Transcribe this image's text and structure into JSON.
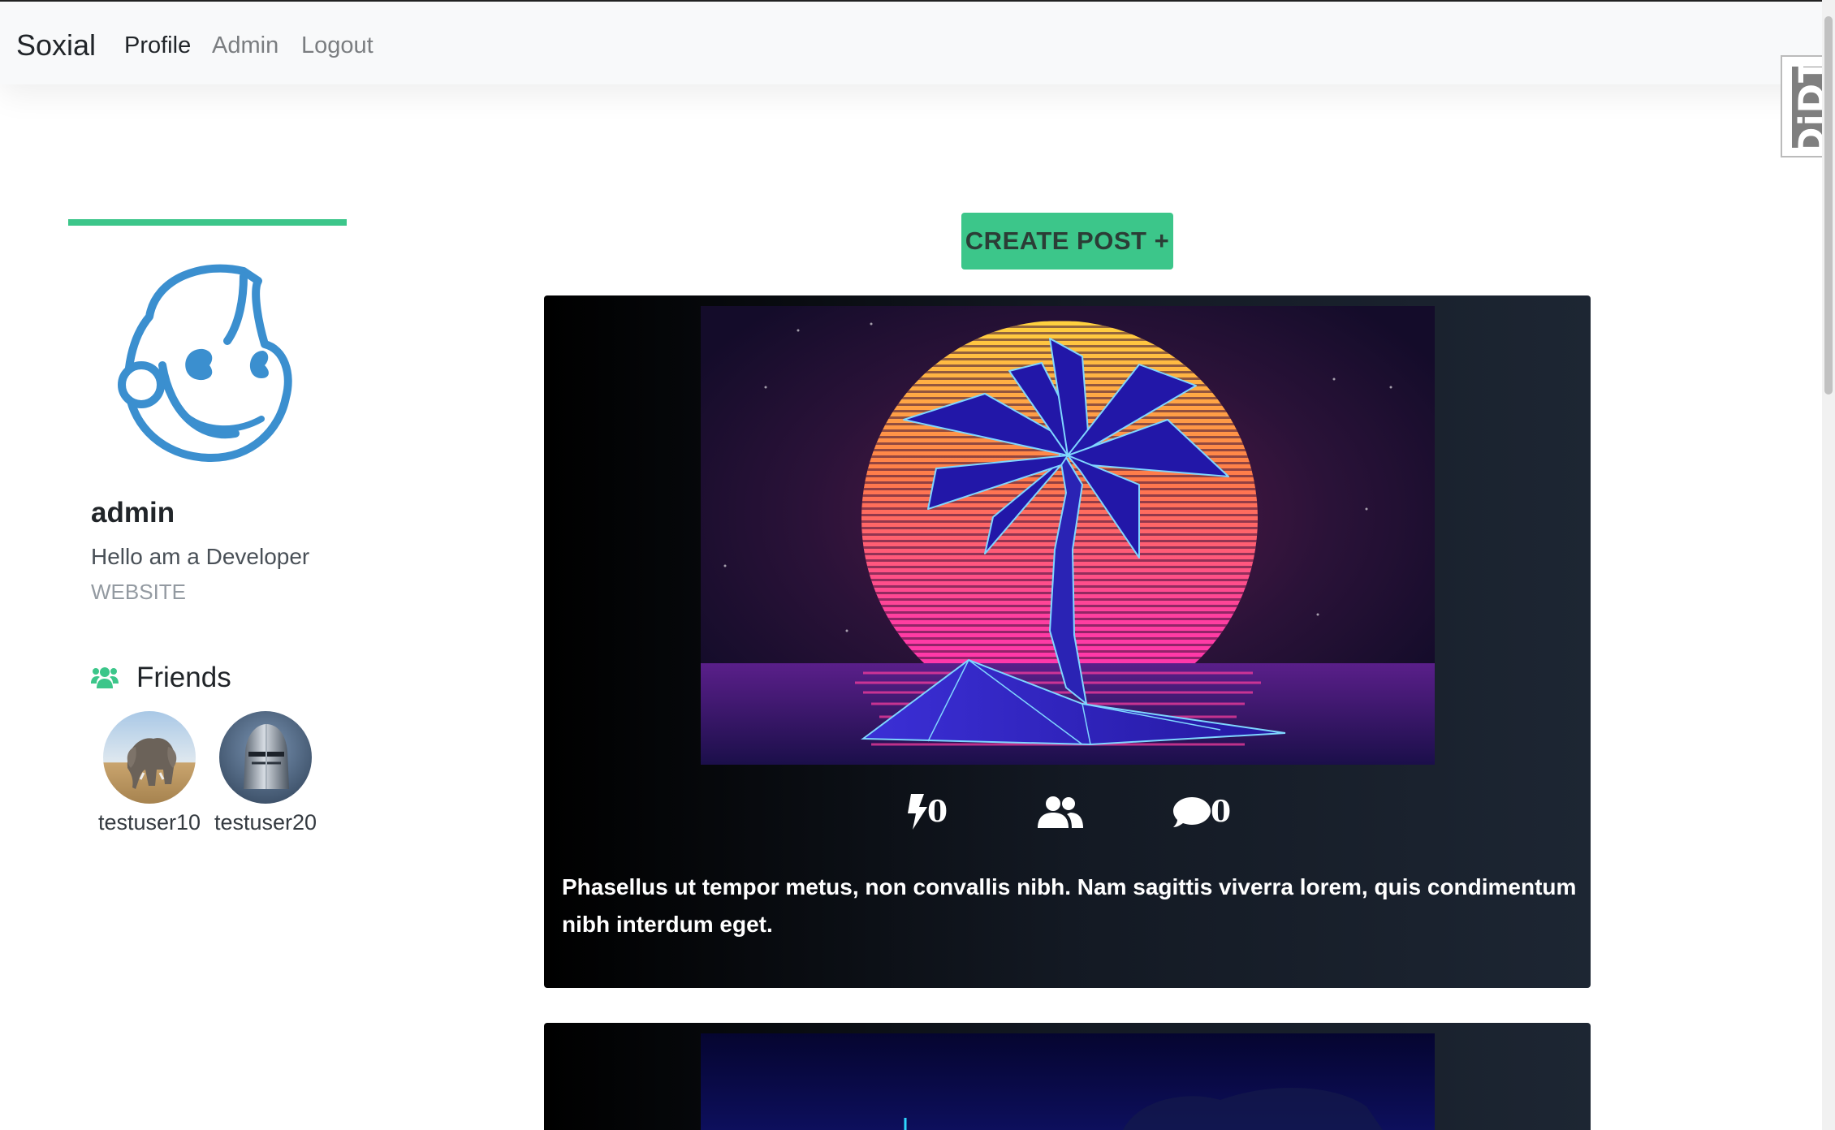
{
  "navbar": {
    "brand": "Soxial",
    "links": [
      {
        "label": "Profile",
        "active": true
      },
      {
        "label": "Admin",
        "active": false
      },
      {
        "label": "Logout",
        "active": false
      }
    ]
  },
  "debug_toolbar": {
    "label": "DjDT"
  },
  "profile": {
    "username": "admin",
    "bio": "Hello am a Developer",
    "website_label": "WEBSITE",
    "accent_color": "#3cc68a"
  },
  "friends": {
    "title": "Friends",
    "list": [
      {
        "name": "testuser10"
      },
      {
        "name": "testuser20"
      }
    ]
  },
  "main": {
    "create_post_label": "CREATE POST +"
  },
  "posts": [
    {
      "power_count": "0",
      "comment_count": "0",
      "text": "Phasellus ut tempor metus, non convallis nibh. Nam sagittis viverra lorem, quis condimentum nibh interdum eget."
    }
  ]
}
